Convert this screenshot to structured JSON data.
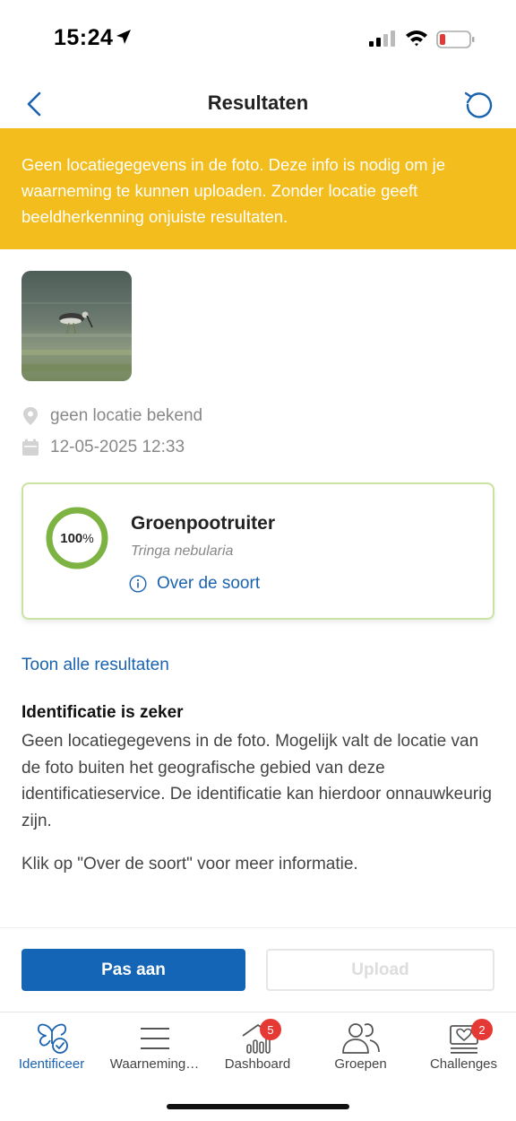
{
  "status_bar": {
    "time": "15:24"
  },
  "nav": {
    "title": "Resultaten"
  },
  "warning": {
    "text": "Geen locatiegegevens in de foto. Deze info is nodig om je waarneming te kunnen uploaden. Zonder locatie geeft beeldherkenning onjuiste resultaten.",
    "color": "#f2bd1d"
  },
  "observation": {
    "location": "geen locatie bekend",
    "datetime": "12-05-2025 12:33"
  },
  "result": {
    "confidence_number": "100",
    "confidence_unit": "%",
    "confidence_fraction": 1.0,
    "species_name": "Groenpootruiter",
    "scientific_name": "Tringa nebularia",
    "about_label": "Over de soort",
    "ring_color": "#7cb342"
  },
  "show_all_label": "Toon alle resultaten",
  "identification": {
    "heading": "Identificatie is zeker",
    "body": "Geen locatiegegevens in de foto. Mogelijk valt de locatie van de foto buiten het geografische gebied van deze identificatieservice. De identificatie kan hierdoor onnauwkeurig zijn.",
    "hint": "Klik op \"Over de soort\" voor meer informatie."
  },
  "actions": {
    "edit_label": "Pas aan",
    "upload_label": "Upload",
    "primary_color": "#1565b7"
  },
  "tabs": [
    {
      "label": "Identificeer",
      "icon": "butterfly-check-icon",
      "active": true
    },
    {
      "label": "Waarneming…",
      "icon": "list-icon",
      "active": false
    },
    {
      "label": "Dashboard",
      "icon": "dashboard-chart-icon",
      "active": false,
      "badge": "5"
    },
    {
      "label": "Groepen",
      "icon": "group-icon",
      "active": false
    },
    {
      "label": "Challenges",
      "icon": "heart-cards-icon",
      "active": false,
      "badge": "2"
    }
  ],
  "accent_color": "#1a63b0"
}
